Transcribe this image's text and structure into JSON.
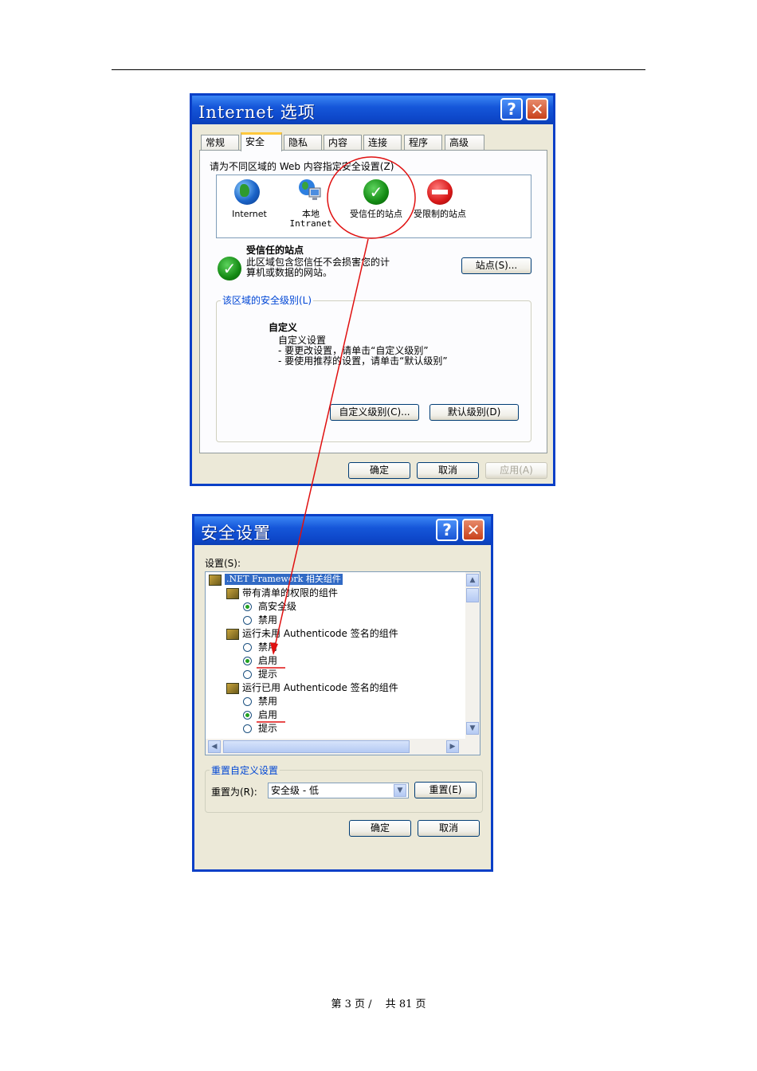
{
  "internet_options": {
    "title": "Internet 选项",
    "tabs": [
      "常规",
      "安全",
      "隐私",
      "内容",
      "连接",
      "程序",
      "高级"
    ],
    "zone_prompt": "请为不同区域的 Web 内容指定安全设置(Z)",
    "zones": [
      {
        "label": "Internet",
        "icon": "globe-icon"
      },
      {
        "label": "本地 Intranet",
        "icon": "local-intranet-icon"
      },
      {
        "label": "受信任的站点",
        "icon": "checkmark-icon"
      },
      {
        "label": "受限制的站点",
        "icon": "no-entry-icon"
      }
    ],
    "selected_zone_title": "受信任的站点",
    "selected_zone_desc_1": "此区域包含您信任不会损害您的计",
    "selected_zone_desc_2": "算机或数据的网站。",
    "sites_button": "站点(S)...",
    "security_level_label": "该区域的安全级别(L)",
    "level_title": "自定义",
    "level_line_1": "自定义设置",
    "level_line_2": "- 要更改设置，请单击“自定义级别”",
    "level_line_3": "- 要使用推荐的设置，请单击“默认级别”",
    "custom_level_button": "自定义级别(C)...",
    "default_level_button": "默认级别(D)",
    "ok_button": "确定",
    "cancel_button": "取消",
    "apply_button": "应用(A)"
  },
  "security_settings": {
    "title": "安全设置",
    "settings_label": "设置(S):",
    "tree": {
      "root": ".NET Framework 相关组件",
      "group_1": "带有清单的权限的组件",
      "group_1_options": [
        "高安全级",
        "禁用"
      ],
      "group_2": "运行未用 Authenticode 签名的组件",
      "group_2_options": [
        "禁用",
        "启用",
        "提示"
      ],
      "group_3": "运行已用 Authenticode 签名的组件",
      "group_3_options": [
        "禁用",
        "启用",
        "提示"
      ]
    },
    "reset_group_label": "重置自定义设置",
    "reset_to_label": "重置为(R):",
    "reset_to_value": "安全级 - 低",
    "reset_button": "重置(E)",
    "ok_button": "确定",
    "cancel_button": "取消"
  },
  "footer": {
    "page_label": "第 3 页 /　 共 81 页"
  },
  "colors": {
    "titlebar": "#0d47c9",
    "annotation": "#e01010",
    "dialog_bg": "#ece9d8"
  }
}
